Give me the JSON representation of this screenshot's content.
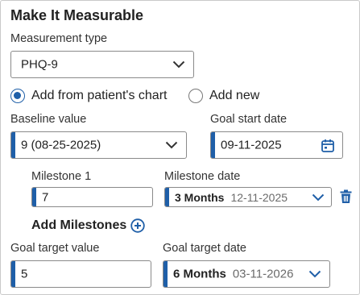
{
  "title": "Make It Measurable",
  "measurement": {
    "label": "Measurement type",
    "value": "PHQ-9"
  },
  "source": {
    "option_chart": "Add from patient's chart",
    "option_new": "Add new",
    "selected": "chart"
  },
  "baseline": {
    "label": "Baseline value",
    "value": "9 (08-25-2025)"
  },
  "goal_start": {
    "label": "Goal start date",
    "value": "09-11-2025"
  },
  "milestone": {
    "value_label": "Milestone 1",
    "value": "7",
    "date_label": "Milestone date",
    "date_period": "3 Months",
    "date_value": "12-11-2025"
  },
  "add_milestones_label": "Add Milestones",
  "goal_target": {
    "value_label": "Goal target value",
    "value": "5",
    "date_label": "Goal target date",
    "date_period": "6 Months",
    "date_value": "03-11-2026"
  },
  "colors": {
    "accent": "#1f5fa8",
    "border": "#8a8a8a"
  },
  "icons": [
    "chevron-down-icon",
    "calendar-icon",
    "trash-icon",
    "plus-circle-icon"
  ]
}
